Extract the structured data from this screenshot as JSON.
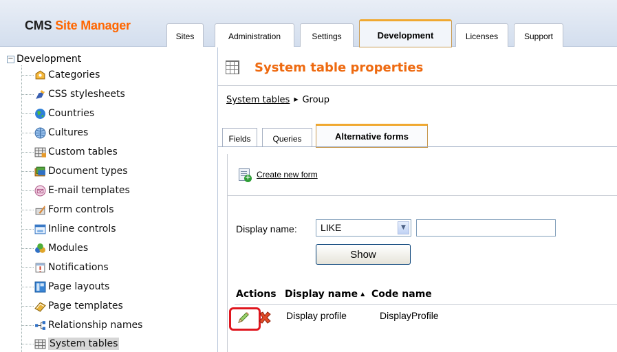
{
  "header": {
    "logo_cms": "CMS",
    "logo_site_manager": "Site Manager",
    "tabs": [
      {
        "label": "Sites",
        "active": false
      },
      {
        "label": "Administration",
        "active": false
      },
      {
        "label": "Settings",
        "active": false
      },
      {
        "label": "Development",
        "active": true
      },
      {
        "label": "Licenses",
        "active": false
      },
      {
        "label": "Support",
        "active": false
      }
    ]
  },
  "tree": {
    "root": "Development",
    "items": [
      {
        "label": "Categories",
        "icon": "categories-icon"
      },
      {
        "label": "CSS stylesheets",
        "icon": "css-stylesheets-icon"
      },
      {
        "label": "Countries",
        "icon": "globe-icon"
      },
      {
        "label": "Cultures",
        "icon": "cultures-icon"
      },
      {
        "label": "Custom tables",
        "icon": "custom-tables-icon"
      },
      {
        "label": "Document types",
        "icon": "document-types-icon"
      },
      {
        "label": "E-mail templates",
        "icon": "email-icon"
      },
      {
        "label": "Form controls",
        "icon": "form-controls-icon"
      },
      {
        "label": "Inline controls",
        "icon": "inline-controls-icon"
      },
      {
        "label": "Modules",
        "icon": "modules-icon"
      },
      {
        "label": "Notifications",
        "icon": "notifications-icon"
      },
      {
        "label": "Page layouts",
        "icon": "page-layouts-icon"
      },
      {
        "label": "Page templates",
        "icon": "page-templates-icon"
      },
      {
        "label": "Relationship names",
        "icon": "relationship-icon"
      },
      {
        "label": "System tables",
        "icon": "system-tables-icon",
        "selected": true
      }
    ]
  },
  "main": {
    "title": "System table properties",
    "breadcrumb": {
      "link": "System tables",
      "current": "Group"
    },
    "subtabs": [
      {
        "label": "Fields",
        "active": false
      },
      {
        "label": "Queries",
        "active": false
      },
      {
        "label": "Alternative forms",
        "active": true
      }
    ],
    "create_link": "Create new form",
    "filter": {
      "label": "Display name:",
      "operator": "LIKE",
      "value": "",
      "button": "Show"
    },
    "grid": {
      "headers": {
        "actions": "Actions",
        "display_name": "Display name",
        "code_name": "Code name"
      },
      "rows": [
        {
          "display_name": "Display profile",
          "code_name": "DisplayProfile"
        }
      ]
    }
  },
  "colors": {
    "accent_orange": "#ee6a10",
    "highlight_red": "#e0161e",
    "tab_active_border": "#f0a830"
  }
}
